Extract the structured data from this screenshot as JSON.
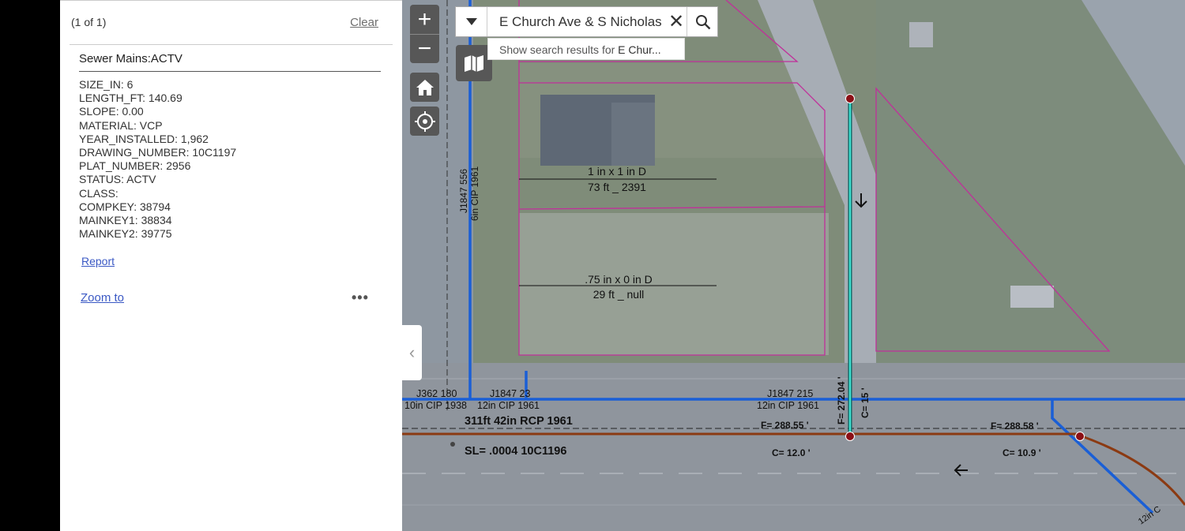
{
  "popup": {
    "count": "(1 of 1)",
    "clear": "Clear",
    "title": "Sewer Mains:ACTV",
    "attributes": [
      "SIZE_IN: 6",
      "LENGTH_FT: 140.69",
      "SLOPE: 0.00",
      "MATERIAL: VCP",
      "YEAR_INSTALLED: 1,962",
      "DRAWING_NUMBER: 10C1197",
      "PLAT_NUMBER: 2956",
      "STATUS: ACTV",
      "CLASS:",
      "COMPKEY: 38794",
      "MAINKEY1: 38834",
      "MAINKEY2: 39775"
    ],
    "report": "Report",
    "zoom_to": "Zoom to",
    "more": "•••"
  },
  "search": {
    "value": "E Church Ave & S Nicholas",
    "clear": "✕",
    "suggestion_prefix": "Show search results for ",
    "suggestion_term": "E Chur..."
  },
  "controls": {
    "zoom_in": "+",
    "zoom_out": "−",
    "collapse": "‹"
  },
  "map_labels": {
    "lot1_line1": "1 in x 1 in D",
    "lot1_line2": "73 ft _ 2391",
    "lot2_line1": ".75 in x 0 in D",
    "lot2_line2": "29 ft _ null",
    "vert_main_id": "J1847 556",
    "vert_main_desc": "6in CIP 1961",
    "j362_id": "J362 180",
    "j362_desc": "10in CIP 1938",
    "j1847_23_id": "J1847 23",
    "j1847_23_desc": "12in CIP 1961",
    "j1847_215_id": "J1847 215",
    "j1847_215_desc": "12in CIP 1961",
    "sewer_main": "311ft  42in  RCP  1961",
    "sewer_slope": "SL= .0004   10C1196",
    "f_left": "F= 288.55 '",
    "c_left": "C= 12.0 '",
    "f_right": "F= 288.58 '",
    "c_right": "C= 10.9 '",
    "f_vert": "F= 272.04 '",
    "c_vert": "C= 15 '",
    "corner_label": "12in C"
  },
  "colors": {
    "water_main": "#1a5fd6",
    "sewer_main": "#8b3a12",
    "parcel": "#c0309a",
    "selected_lateral": "#3fe0d0",
    "manhole": "#8b0f16",
    "link": "#3a58c4"
  }
}
